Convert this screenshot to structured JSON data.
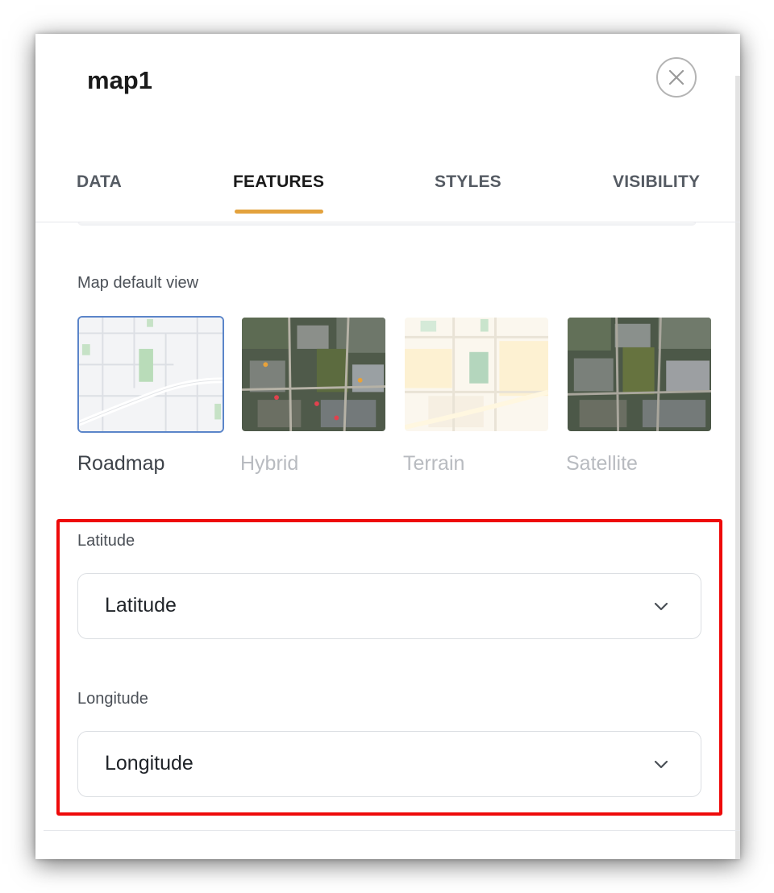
{
  "panel": {
    "title": "map1",
    "close_icon": "close-icon"
  },
  "tabs": [
    {
      "label": "DATA",
      "active": false
    },
    {
      "label": "FEATURES",
      "active": true
    },
    {
      "label": "STYLES",
      "active": false
    },
    {
      "label": "VISIBILITY",
      "active": false
    }
  ],
  "colors": {
    "active_tab_underline": "#e3a23d",
    "selected_view_border": "#5b85c9",
    "highlight_box": "#ee0a0a"
  },
  "map_default_view": {
    "label": "Map default view",
    "options": [
      {
        "label": "Roadmap",
        "selected": true
      },
      {
        "label": "Hybrid",
        "selected": false
      },
      {
        "label": "Terrain",
        "selected": false
      },
      {
        "label": "Satellite",
        "selected": false
      }
    ]
  },
  "latitude": {
    "label": "Latitude",
    "value": "Latitude",
    "icon": "chevron-down-icon"
  },
  "longitude": {
    "label": "Longitude",
    "value": "Longitude",
    "icon": "chevron-down-icon"
  }
}
